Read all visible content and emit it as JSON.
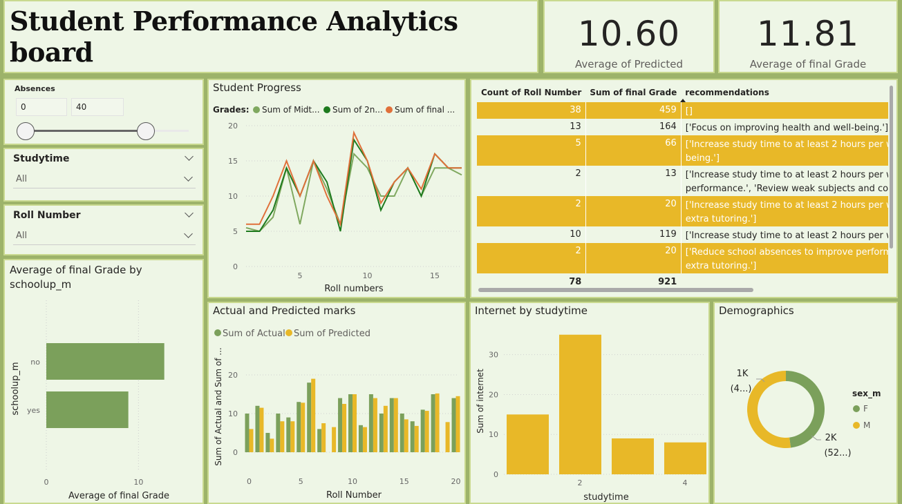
{
  "header": {
    "title": "Student Performance Analytics board"
  },
  "kpis": [
    {
      "value": "10.60",
      "label": "Average of Predicted"
    },
    {
      "value": "11.81",
      "label": "Average of final Grade"
    }
  ],
  "absences": {
    "title": "Absences",
    "min": "0",
    "max": "40"
  },
  "studytime_slicer": {
    "title": "Studytime",
    "value": "All"
  },
  "roll_slicer": {
    "title": "Roll Number",
    "value": "All"
  },
  "school_chart": {
    "title": "Average of final Grade by schoolup_m",
    "title_line1": "Average of final Grade by",
    "title_line2": "schoolup_m",
    "ylabel": "schoolup_m",
    "xlabel": "Average of final Grade",
    "ticks": [
      "0",
      "10"
    ],
    "categories": [
      "no",
      "yes"
    ]
  },
  "progress_chart": {
    "title": "Student Progress",
    "legend_title": "Grades:",
    "series_names": [
      "Sum of Midt...",
      "Sum of 2n...",
      "Sum of final ..."
    ],
    "xlabel": "Roll numbers",
    "yticks": [
      "0",
      "5",
      "10",
      "15",
      "20"
    ],
    "xticks": [
      "5",
      "10",
      "15"
    ]
  },
  "table": {
    "headers": [
      "Count of Roll Number",
      "Sum of final Grade",
      "recommendations"
    ],
    "rows": [
      {
        "count": "38",
        "sum": "459",
        "rec": "[]",
        "rec2": ""
      },
      {
        "count": "13",
        "sum": "164",
        "rec": "['Focus on improving health and well-being.']",
        "rec2": ""
      },
      {
        "count": "5",
        "sum": "66",
        "rec": "['Increase study time to at least 2 hours per w",
        "rec2": "being.']"
      },
      {
        "count": "2",
        "sum": "13",
        "rec": "['Increase study time to at least 2 hours per w",
        "rec2": "performance.', 'Review weak subjects and con"
      },
      {
        "count": "2",
        "sum": "20",
        "rec": "['Increase study time to at least 2 hours per w",
        "rec2": "extra tutoring.']"
      },
      {
        "count": "10",
        "sum": "119",
        "rec": "['Increase study time to at least 2 hours per w",
        "rec2": ""
      },
      {
        "count": "2",
        "sum": "20",
        "rec": "['Reduce school absences to improve perform",
        "rec2": "extra tutoring.']"
      }
    ],
    "total": {
      "count": "78",
      "sum": "921"
    }
  },
  "actual_chart": {
    "title": "Actual and Predicted marks",
    "legend": [
      "Sum of Actual",
      "Sum of Predicted"
    ],
    "ylabel": "Sum of Actual and Sum of ...",
    "xlabel": "Roll Number",
    "yticks": [
      "0",
      "10",
      "20"
    ],
    "xticks": [
      "0",
      "5",
      "10",
      "15",
      "20"
    ]
  },
  "internet_chart": {
    "title": "Internet by studytime",
    "ylabel": "Sum of internet",
    "xlabel": "studytime",
    "yticks": [
      "0",
      "10",
      "20",
      "30"
    ],
    "xticks": [
      "2",
      "4"
    ]
  },
  "demographics": {
    "title": "Demographics",
    "legend_title": "sex_m",
    "legend": [
      "F",
      "M"
    ],
    "label_top_1": "1K",
    "label_top_2": "(4...)",
    "label_bot_1": "2K",
    "label_bot_2": "(52...)"
  },
  "colors": {
    "green": "#7ba05b",
    "dark_green": "#1e7a1e",
    "orange": "#e0703a",
    "yellow": "#e8b828",
    "light_green": "#7fa85f"
  },
  "chart_data": [
    {
      "type": "bar",
      "title": "Average of final Grade by schoolup_m",
      "categories": [
        "no",
        "yes"
      ],
      "values": [
        12.8,
        8.9
      ],
      "xlabel": "Average of final Grade",
      "ylabel": "schoolup_m",
      "xlim": [
        0,
        15
      ]
    },
    {
      "type": "line",
      "title": "Student Progress",
      "x": [
        1,
        2,
        3,
        4,
        5,
        6,
        7,
        8,
        9,
        10,
        11,
        12,
        13,
        14,
        15,
        16,
        17
      ],
      "series": [
        {
          "name": "Sum of Midt...",
          "values": [
            5.5,
            5,
            7,
            14,
            6,
            15,
            11,
            6,
            16,
            14,
            10,
            10,
            14,
            10,
            14,
            14,
            13
          ]
        },
        {
          "name": "Sum of 2n...",
          "values": [
            5,
            5,
            8,
            14,
            10,
            15,
            12,
            5,
            18,
            15,
            8,
            12,
            14,
            10,
            16,
            14,
            14
          ]
        },
        {
          "name": "Sum of final ...",
          "values": [
            6,
            6,
            10,
            15,
            10,
            15,
            10,
            6,
            19,
            15,
            9,
            12,
            14,
            11,
            16,
            14,
            14
          ]
        }
      ],
      "xlabel": "Roll numbers",
      "ylim": [
        0,
        20
      ]
    },
    {
      "type": "bar",
      "title": "Actual and Predicted marks",
      "x": [
        0,
        1,
        2,
        3,
        4,
        5,
        6,
        7,
        8,
        9,
        10,
        11,
        12,
        13,
        14,
        15,
        16,
        17,
        18,
        19,
        20
      ],
      "series": [
        {
          "name": "Sum of Actual",
          "values": [
            10,
            12,
            5,
            10,
            9,
            13,
            18,
            6,
            0,
            14,
            15,
            7,
            15,
            10,
            14,
            10,
            8,
            11,
            15,
            0,
            14
          ]
        },
        {
          "name": "Sum of Predicted",
          "values": [
            6,
            11.5,
            3.5,
            8,
            8,
            12.8,
            19,
            7.5,
            6.5,
            12.5,
            15,
            6.5,
            14,
            12,
            14,
            8.5,
            6.8,
            10.7,
            15.2,
            7.8,
            14.5
          ]
        }
      ],
      "xlabel": "Roll Number",
      "ylabel": "Sum of Actual and Sum of ...",
      "ylim": [
        0,
        25
      ]
    },
    {
      "type": "bar",
      "title": "Internet by studytime",
      "categories": [
        "1",
        "2",
        "3",
        "4"
      ],
      "values": [
        15,
        35,
        9,
        8
      ],
      "xlabel": "studytime",
      "ylabel": "Sum of internet",
      "ylim": [
        0,
        36
      ]
    },
    {
      "type": "pie",
      "title": "Demographics",
      "categories": [
        "F",
        "M"
      ],
      "values": [
        48,
        52
      ]
    }
  ]
}
